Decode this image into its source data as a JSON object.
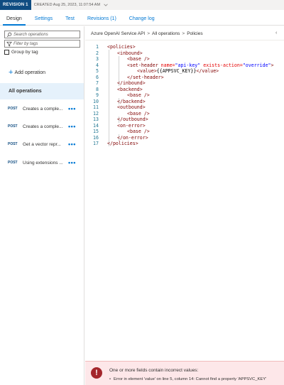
{
  "revision": {
    "badge": "REVISION 1",
    "created": "CREATED Aug 25, 2023, 11:07:54 AM"
  },
  "tabs": [
    {
      "label": "Design",
      "active": true
    },
    {
      "label": "Settings",
      "active": false
    },
    {
      "label": "Test",
      "active": false
    },
    {
      "label": "Revisions (1)",
      "active": false
    },
    {
      "label": "Change log",
      "active": false
    }
  ],
  "sidebar": {
    "search_placeholder": "Search operations",
    "filter_placeholder": "Filter by tags",
    "group_by_tag": "Group by tag",
    "add_operation": "Add operation",
    "all_operations": "All operations",
    "operations": [
      {
        "method": "POST",
        "name": "Creates a comple..."
      },
      {
        "method": "POST",
        "name": "Creates a comple..."
      },
      {
        "method": "POST",
        "name": "Get a vector repr..."
      },
      {
        "method": "POST",
        "name": "Using extensions ..."
      }
    ]
  },
  "breadcrumb": [
    "Azure OpenAI Service API",
    "All operations",
    "Policies"
  ],
  "editor": {
    "line_numbers": [
      "1",
      "2",
      "3",
      "4",
      "5",
      "6",
      "7",
      "8",
      "9",
      "10",
      "11",
      "12",
      "13",
      "14",
      "15",
      "16",
      "17"
    ],
    "lines": [
      "<policies>",
      "<inbound>",
      "<base />",
      "<set-header",
      "<value>",
      "</set-header>",
      "</inbound>",
      "<backend>",
      "<base />",
      "</backend>",
      "<outbound>",
      "<base />",
      "</outbound>",
      "<on-error>",
      "<base />",
      "</on-error>",
      "</policies>"
    ],
    "set_header_attr1": "name=",
    "set_header_val1": "\"api-key\"",
    "set_header_attr2": "exists-action=",
    "set_header_val2": "\"override\"",
    "set_header_close": ">",
    "value_text": "{{APPSVC_KEY}}",
    "value_close": "</value>"
  },
  "error": {
    "title": "One or more fields contain incorrect values:",
    "item": "Error in element 'value' on line 5, column 14: Cannot find a property 'APPSVC_KEY'"
  },
  "colors": {
    "accent": "#0078d4",
    "badge": "#0f4c81",
    "error": "#a4262c",
    "error_bg": "#fde7e9"
  }
}
